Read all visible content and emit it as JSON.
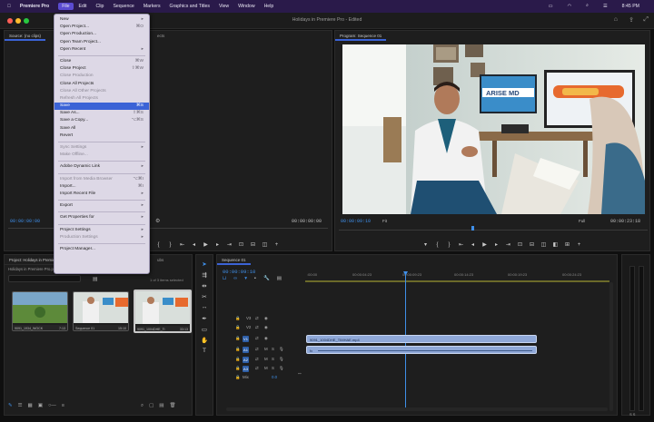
{
  "mac_menu": {
    "apple": "",
    "app_name": "Premiere Pro",
    "items": [
      "File",
      "Edit",
      "Clip",
      "Sequence",
      "Markers",
      "Graphics and Titles",
      "View",
      "Window",
      "Help"
    ],
    "time": "8:45 PM"
  },
  "window_title": "Holidays in Premiere Pro - Edited",
  "source_panel": {
    "tab_label": "Source: (no clips)",
    "tab_suffix": "ects",
    "tc_left": "00:00:00:00",
    "tc_right": "00:00:00:00"
  },
  "program_panel": {
    "tab_label": "Program: Sequence 01",
    "tc_left": "00:00:09:10",
    "fit": "Fit",
    "quality": "Full",
    "tc_right": "00:00:23:18",
    "sign_text": "ARISE MD"
  },
  "file_menu": {
    "items": [
      {
        "label": "New",
        "shortcut": "▸",
        "state": "normal"
      },
      {
        "label": "Open Project...",
        "shortcut": "⌘O",
        "state": "normal"
      },
      {
        "label": "Open Production...",
        "shortcut": "",
        "state": "normal"
      },
      {
        "label": "Open Team Project...",
        "shortcut": "",
        "state": "normal"
      },
      {
        "label": "Open Recent",
        "shortcut": "▸",
        "state": "normal"
      },
      {
        "sep": true
      },
      {
        "label": "Close",
        "shortcut": "⌘W",
        "state": "normal"
      },
      {
        "label": "Close Project",
        "shortcut": "⇧⌘W",
        "state": "normal"
      },
      {
        "label": "Close Production",
        "shortcut": "",
        "state": "dis"
      },
      {
        "label": "Close All Projects",
        "shortcut": "",
        "state": "normal"
      },
      {
        "label": "Close All Other Projects",
        "shortcut": "",
        "state": "dis"
      },
      {
        "label": "Refresh All Projects",
        "shortcut": "",
        "state": "dis"
      },
      {
        "label": "Save",
        "shortcut": "⌘S",
        "state": "sel"
      },
      {
        "label": "Save As...",
        "shortcut": "⇧⌘S",
        "state": "normal"
      },
      {
        "label": "Save a Copy...",
        "shortcut": "⌥⌘S",
        "state": "normal"
      },
      {
        "label": "Save All",
        "shortcut": "",
        "state": "normal"
      },
      {
        "label": "Revert",
        "shortcut": "",
        "state": "normal"
      },
      {
        "sep": true
      },
      {
        "label": "Sync Settings",
        "shortcut": "▸",
        "state": "dis"
      },
      {
        "label": "Make Offline...",
        "shortcut": "",
        "state": "dis"
      },
      {
        "sep": true
      },
      {
        "label": "Adobe Dynamic Link",
        "shortcut": "▸",
        "state": "normal"
      },
      {
        "sep": true
      },
      {
        "label": "Import from Media Browser",
        "shortcut": "⌥⌘I",
        "state": "dis"
      },
      {
        "label": "Import...",
        "shortcut": "⌘I",
        "state": "normal"
      },
      {
        "label": "Import Recent File",
        "shortcut": "▸",
        "state": "normal"
      },
      {
        "sep": true
      },
      {
        "label": "Export",
        "shortcut": "▸",
        "state": "normal"
      },
      {
        "sep": true
      },
      {
        "label": "Get Properties for",
        "shortcut": "▸",
        "state": "normal"
      },
      {
        "sep": true
      },
      {
        "label": "Project Settings",
        "shortcut": "▸",
        "state": "normal"
      },
      {
        "label": "Production Settings",
        "shortcut": "▸",
        "state": "dis"
      },
      {
        "sep": true
      },
      {
        "label": "Project Manager...",
        "shortcut": "",
        "state": "normal"
      }
    ]
  },
  "project_panel": {
    "tab_label": "Project: Holidays in Premiere Pro",
    "tab_suffix": "ubs",
    "breadcrumb": "Holidays in Premiere Pro.prproj",
    "selection": "1 of 3 items selected",
    "thumbs": [
      {
        "name": "9091_1934_WOCK",
        "dur": "7:13"
      },
      {
        "name": "Sequence 01",
        "dur": "15:10"
      },
      {
        "name": "9091_1004DHE_Ti",
        "dur": "33:13"
      }
    ]
  },
  "timeline": {
    "tab_label": "Sequence 01",
    "timecode": "00:00:09:10",
    "ruler": [
      ":00:00",
      "00:00:04:23",
      "00:00:09:23",
      "00:00:14:23",
      "00:00:19:23",
      "00:00:24:23"
    ],
    "tracks": [
      "V3",
      "V2",
      "V1",
      "A1",
      "A2",
      "A3"
    ],
    "mix_label": "Mix",
    "mix_value": "0.0",
    "clip_v1": "9091_1004DHE_TIMHAE.mp4",
    "clip_a1_icon": "fx"
  },
  "colors": {
    "accent_blue": "#3b63d6",
    "timecode_blue": "#3f8fe8",
    "clip_blue": "#8fa8d8",
    "menubar_purple": "#2a1a4a"
  }
}
